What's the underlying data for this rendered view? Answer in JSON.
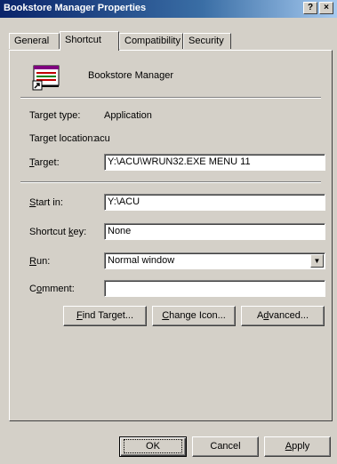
{
  "window": {
    "title": "Bookstore Manager Properties",
    "help_label": "?",
    "close_label": "×"
  },
  "tabs": [
    {
      "label": "General"
    },
    {
      "label": "Shortcut"
    },
    {
      "label": "Compatibility"
    },
    {
      "label": "Security"
    }
  ],
  "shortcut": {
    "app_name": "Bookstore Manager",
    "target_type_label": "Target type:",
    "target_type_value": "Application",
    "target_location_label": "Target location:",
    "target_location_value": "acu",
    "target_label_pre": "",
    "target_label_accel": "T",
    "target_label_post": "arget:",
    "target_value": "Y:\\ACU\\WRUN32.EXE MENU 11",
    "start_in_label_accel": "S",
    "start_in_label_post": "tart in:",
    "start_in_value": "Y:\\ACU",
    "shortcut_key_label_pre": "Shortcut ",
    "shortcut_key_label_accel": "k",
    "shortcut_key_label_post": "ey:",
    "shortcut_key_value": "None",
    "run_label_accel": "R",
    "run_label_post": "un:",
    "run_value": "Normal window",
    "comment_label_pre": "C",
    "comment_label_accel": "o",
    "comment_label_post": "mment:",
    "comment_value": "",
    "find_target_accel": "F",
    "find_target_post": "ind Target...",
    "change_icon_accel": "C",
    "change_icon_post": "hange Icon...",
    "advanced_pre": "A",
    "advanced_accel": "d",
    "advanced_post": "vanced..."
  },
  "footer": {
    "ok_label": "OK",
    "cancel_label": "Cancel",
    "apply_accel": "A",
    "apply_post": "pply"
  },
  "icons": {
    "app_icon": "shortcut-app-icon",
    "dropdown": "chevron-down-icon"
  }
}
